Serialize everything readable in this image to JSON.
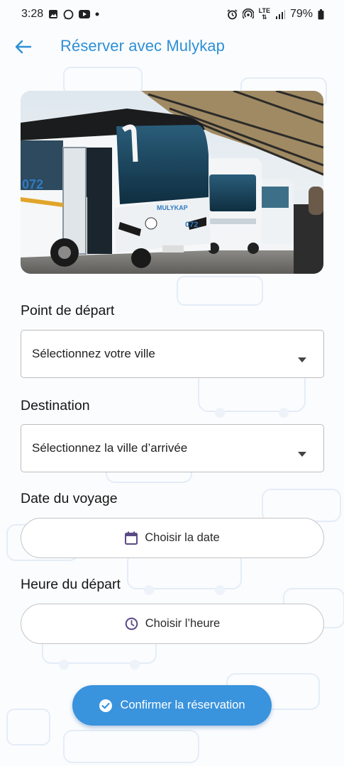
{
  "status_bar": {
    "time": "3:28",
    "network": "LTE",
    "battery": "79%"
  },
  "app_bar": {
    "title": "Réserver avec Mulykap"
  },
  "hero": {
    "bus_number_left": "072",
    "bus_number_front": "072",
    "bus_brand": "MULYKAP"
  },
  "form": {
    "departure": {
      "label": "Point de départ",
      "placeholder": "Sélectionnez votre ville"
    },
    "destination": {
      "label": "Destination",
      "placeholder": "Sélectionnez la ville d’arrivée"
    },
    "date": {
      "label": "Date du voyage",
      "button_label": "Choisir la date"
    },
    "time": {
      "label": "Heure du départ",
      "button_label": "Choisir l’heure"
    },
    "confirm_label": "Confirmer la réservation"
  },
  "colors": {
    "accent": "#2d8fd5",
    "button": "#3a93dd",
    "icon_purple": "#5b4a86"
  }
}
